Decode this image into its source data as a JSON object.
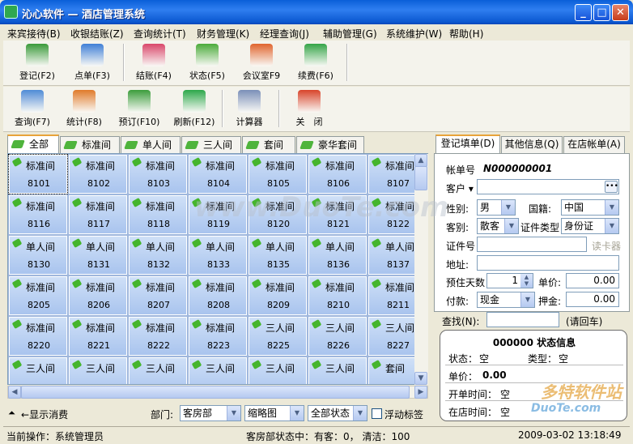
{
  "window": {
    "title": "沁心软件 — 酒店管理系统",
    "min": "_",
    "max": "□",
    "close": "✕"
  },
  "menu": [
    "来宾接待(B)",
    "收银结账(Z)",
    "查询统计(T)",
    "财务管理(K)",
    "经理查询(J)",
    "辅助管理(G)",
    "系统维护(W)",
    "帮助(H)"
  ],
  "toolbar1": [
    {
      "label": "登记(F2)",
      "icon": "register-icon",
      "color": "#3a9a3a"
    },
    {
      "label": "点单(F3)",
      "icon": "order-icon",
      "color": "#3f7fd6"
    },
    {
      "label": "结账(F4)",
      "icon": "checkout-icon",
      "color": "#d9476a"
    },
    {
      "label": "状态(F5)",
      "icon": "status-icon",
      "color": "#4bab3b"
    },
    {
      "label": "会议室F9",
      "icon": "meeting-room-icon",
      "color": "#e0652f"
    },
    {
      "label": "续费(F6)",
      "icon": "renew-icon",
      "color": "#35a548"
    }
  ],
  "toolbar2": [
    {
      "label": "查询(F7)",
      "icon": "search-icon",
      "color": "#4f8bd6"
    },
    {
      "label": "统计(F8)",
      "icon": "statistics-icon",
      "color": "#e07a2a"
    },
    {
      "label": "预订(F10)",
      "icon": "reserve-icon",
      "color": "#3c9d3c"
    },
    {
      "label": "刷新(F12)",
      "icon": "refresh-icon",
      "color": "#2da84a"
    },
    {
      "label": "计算器",
      "icon": "calculator-icon",
      "color": "#7a8fb8"
    },
    {
      "label": "关　闭",
      "icon": "power-icon",
      "color": "#d8442a"
    }
  ],
  "room_tabs": [
    "全部",
    "标准间",
    "单人间",
    "三人间",
    "套间",
    "豪华套间"
  ],
  "rooms": [
    [
      [
        "标准间",
        "8101"
      ],
      [
        "标准间",
        "8102"
      ],
      [
        "标准间",
        "8103"
      ],
      [
        "标准间",
        "8104"
      ],
      [
        "标准间",
        "8105"
      ],
      [
        "标准间",
        "8106"
      ],
      [
        "标准间",
        "8107"
      ]
    ],
    [
      [
        "标准间",
        "8116"
      ],
      [
        "标准间",
        "8117"
      ],
      [
        "标准间",
        "8118"
      ],
      [
        "标准间",
        "8119"
      ],
      [
        "标准间",
        "8120"
      ],
      [
        "标准间",
        "8121"
      ],
      [
        "标准间",
        "8122"
      ]
    ],
    [
      [
        "单人间",
        "8130"
      ],
      [
        "单人间",
        "8131"
      ],
      [
        "单人间",
        "8132"
      ],
      [
        "单人间",
        "8133"
      ],
      [
        "单人间",
        "8135"
      ],
      [
        "单人间",
        "8136"
      ],
      [
        "单人间",
        "8137"
      ]
    ],
    [
      [
        "标准间",
        "8205"
      ],
      [
        "标准间",
        "8206"
      ],
      [
        "标准间",
        "8207"
      ],
      [
        "标准间",
        "8208"
      ],
      [
        "标准间",
        "8209"
      ],
      [
        "标准间",
        "8210"
      ],
      [
        "标准间",
        "8211"
      ]
    ],
    [
      [
        "标准间",
        "8220"
      ],
      [
        "标准间",
        "8221"
      ],
      [
        "标准间",
        "8222"
      ],
      [
        "标准间",
        "8223"
      ],
      [
        "三人间",
        "8225"
      ],
      [
        "三人间",
        "8226"
      ],
      [
        "三人间",
        "8227"
      ]
    ],
    [
      [
        "三人间",
        ""
      ],
      [
        "三人间",
        ""
      ],
      [
        "三人间",
        ""
      ],
      [
        "三人间",
        ""
      ],
      [
        "三人间",
        ""
      ],
      [
        "三人间",
        ""
      ],
      [
        "套间",
        ""
      ]
    ]
  ],
  "bottom": {
    "show_consumption": "显示消费",
    "dept_label": "部门:",
    "dept_value": "客房部",
    "view_value": "缩略图",
    "state_value": "全部状态",
    "float_label": "浮动标签"
  },
  "status": {
    "operator": "当前操作：系统管理员",
    "room_state": "客房部状态中：有客：0， 清洁：100",
    "datetime": "2009-03-02  13:18:49"
  },
  "right_tabs": [
    "登记填单(D)",
    "其他信息(Q)",
    "在店帐单(A)"
  ],
  "form": {
    "account_label": "帐单号",
    "account_value": "N000000001",
    "customer_label": "客户",
    "gender_label": "性别:",
    "gender_value": "男",
    "nationality_label": "国籍:",
    "nationality_value": "中国",
    "guest_type_label": "客别:",
    "guest_type_value": "散客",
    "id_type_label": "证件类型",
    "id_type_value": "身份证",
    "id_no_label": "证件号",
    "read_card": "读卡器",
    "address_label": "地址:",
    "days_label": "预住天数",
    "days_value": "1",
    "price_label": "单价:",
    "price_value": "0.00",
    "payment_label": "付款:",
    "payment_value": "现金",
    "deposit_label": "押金:",
    "deposit_value": "0.00"
  },
  "find": {
    "label": "查找(N):",
    "hint": "(请回车)"
  },
  "info": {
    "title": "000000 状态信息",
    "state_label": "状态：",
    "state_value": "空",
    "type_label": "类型：",
    "type_value": "空",
    "price_label": "单价：",
    "price_value": "0.00",
    "start_label": "开单时间：",
    "start_value": "空",
    "stay_label": "在店时间：",
    "stay_value": "空"
  },
  "watermark": {
    "main": "www.DuoTe.com",
    "corner": "多特软件站",
    "corner_sub": "DuoTe.com"
  }
}
